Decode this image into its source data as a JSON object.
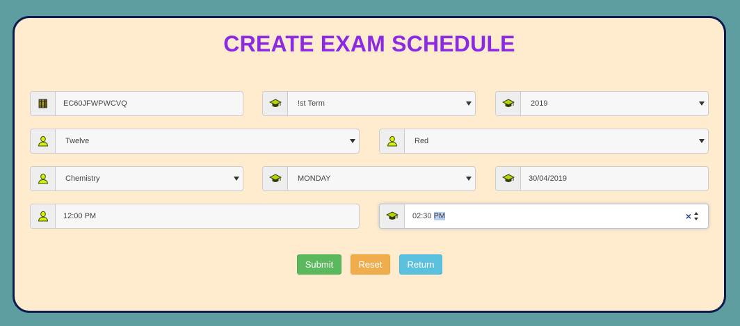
{
  "page": {
    "title": "CREATE EXAM SCHEDULE"
  },
  "icons": {
    "books": "books-icon",
    "graduation": "graduation-cap-icon",
    "user": "user-icon"
  },
  "form": {
    "exam_code": {
      "value": "EC60JFWPWCVQ"
    },
    "term": {
      "value": "!st Term"
    },
    "year": {
      "value": "2019"
    },
    "class": {
      "value": "Twelve"
    },
    "section": {
      "value": "Red"
    },
    "subject": {
      "value": "Chemistry"
    },
    "day": {
      "value": "MONDAY"
    },
    "date": {
      "value": "30/04/2019"
    },
    "start_time": {
      "value": "12:00 PM"
    },
    "end_time": {
      "value_prefix": "02:30 ",
      "value_selected": "PM",
      "clear_symbol": "×"
    }
  },
  "buttons": {
    "submit": "Submit",
    "reset": "Reset",
    "return": "Return"
  },
  "colors": {
    "background": "#5f9ea0",
    "card": "#ffebcd",
    "card_border": "#0d1b4f",
    "title": "#8a2be2",
    "submit": "#5cb85c",
    "reset": "#f0ad4e",
    "return": "#5bc0de"
  }
}
